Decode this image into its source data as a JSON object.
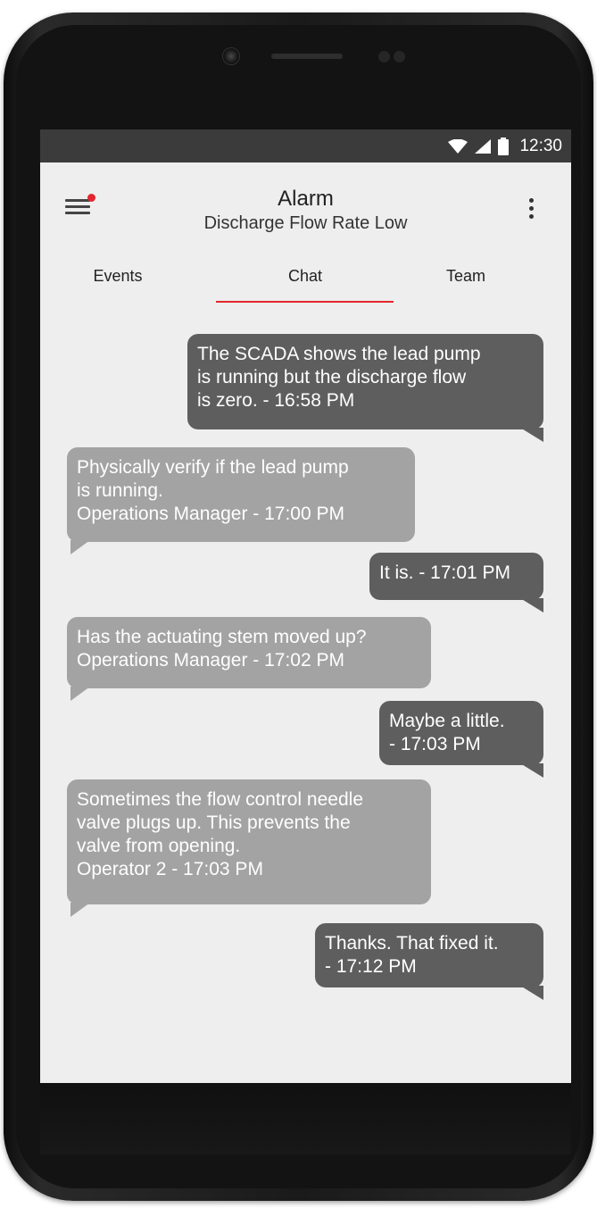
{
  "status_bar": {
    "time": "12:30",
    "icons": [
      "wifi-icon",
      "signal-icon",
      "battery-icon"
    ]
  },
  "app_bar": {
    "title": "Alarm",
    "subtitle": "Discharge Flow Rate Low",
    "menu_icon": "hamburger-menu-icon",
    "notification_dot_color": "#e3262e",
    "overflow_icon": "more-vert-icon"
  },
  "tabs": [
    {
      "label": "Events",
      "active": false
    },
    {
      "label": "Chat",
      "active": true
    },
    {
      "label": "Team",
      "active": false
    }
  ],
  "accent_color": "#e3262e",
  "messages": [
    {
      "direction": "out",
      "lines": [
        "The SCADA shows the lead pump",
        "is running but the discharge flow",
        "is zero. - 16:58 PM"
      ]
    },
    {
      "direction": "in",
      "lines": [
        "Physically verify if the lead pump",
        "is running.",
        "Operations Manager - 17:00 PM"
      ]
    },
    {
      "direction": "out",
      "lines": [
        "It is. - 17:01 PM"
      ]
    },
    {
      "direction": "in",
      "lines": [
        "Has the actuating stem moved up?",
        "Operations Manager - 17:02 PM"
      ]
    },
    {
      "direction": "out",
      "lines": [
        "Maybe a little.",
        "- 17:03 PM"
      ]
    },
    {
      "direction": "in",
      "lines": [
        "Sometimes the flow control needle",
        "valve plugs up. This prevents the",
        "valve from opening.",
        "Operator 2 - 17:03 PM"
      ]
    },
    {
      "direction": "out",
      "lines": [
        "Thanks. That fixed it.",
        "- 17:12 PM"
      ]
    }
  ]
}
